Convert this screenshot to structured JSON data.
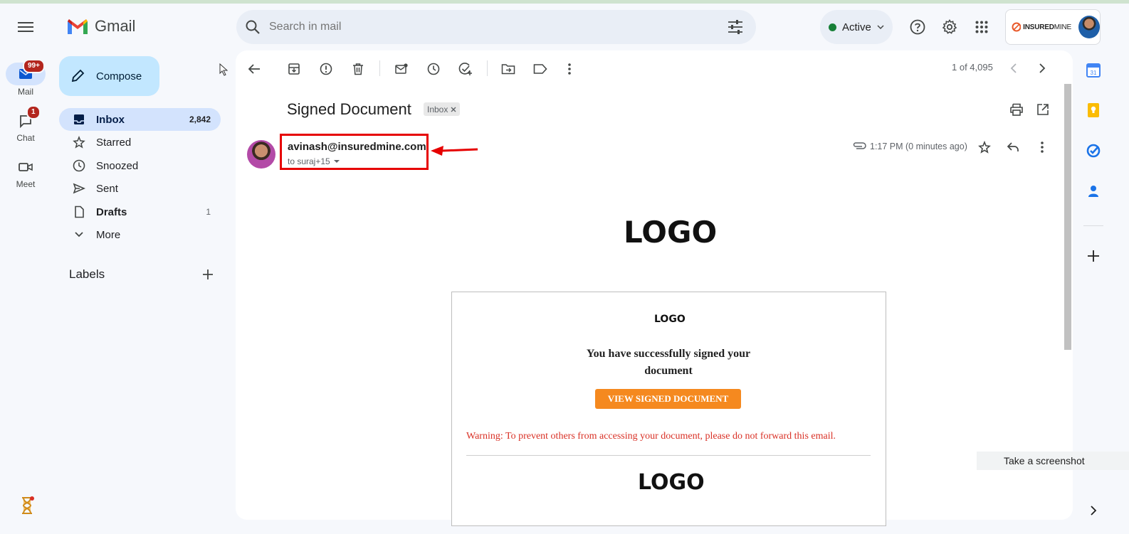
{
  "app": {
    "name": "Gmail"
  },
  "rail": {
    "mail": {
      "label": "Mail",
      "badge": "99+"
    },
    "chat": {
      "label": "Chat",
      "badge": "1"
    },
    "meet": {
      "label": "Meet"
    }
  },
  "nav": {
    "compose": "Compose",
    "items": [
      {
        "label": "Inbox",
        "count": "2,842"
      },
      {
        "label": "Starred",
        "count": ""
      },
      {
        "label": "Snoozed",
        "count": ""
      },
      {
        "label": "Sent",
        "count": ""
      },
      {
        "label": "Drafts",
        "count": "1"
      },
      {
        "label": "More",
        "count": ""
      }
    ],
    "labels_heading": "Labels"
  },
  "header": {
    "search_placeholder": "Search in mail",
    "status": "Active",
    "account_brand": "INSURED",
    "account_brand_suffix": "MINE"
  },
  "toolbar": {
    "pager": "1 of 4,095"
  },
  "email": {
    "subject": "Signed Document",
    "chip": "Inbox",
    "sender": "avinash@insuredmine.com",
    "to": "to suraj+15",
    "time": "1:17 PM (0 minutes ago)",
    "body": {
      "logo_top": "LOGO",
      "logo_card": "LOGO",
      "message": "You have successfully signed your document",
      "cta": "VIEW SIGNED DOCUMENT",
      "warning": "Warning: To prevent others from accessing your document, please do not forward this email.",
      "logo_bottom": "LOGO"
    }
  },
  "tooltip": "Take a screenshot",
  "colors": {
    "accent_compose": "#c2e7ff",
    "nav_active": "#d3e3fd",
    "cta": "#f5891f",
    "warning": "#d93025",
    "highlight": "#e60000"
  }
}
